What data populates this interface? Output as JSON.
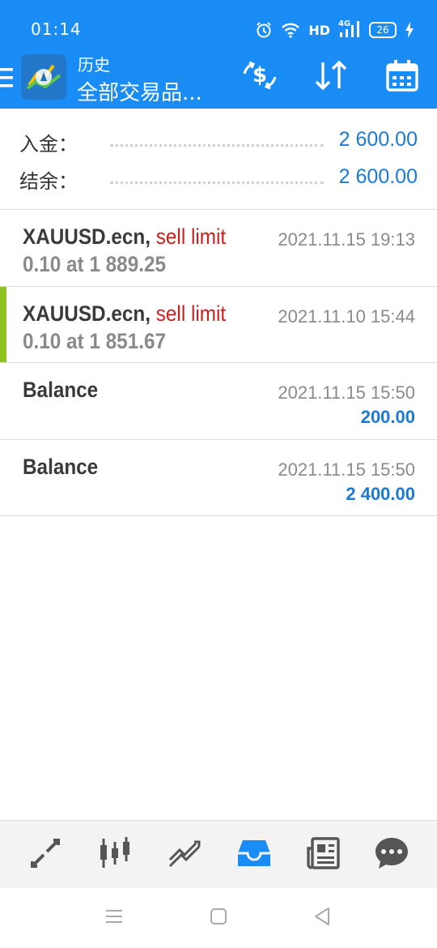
{
  "status_bar": {
    "time": "01:14",
    "network": "HD",
    "signal_label": "4G",
    "battery": "26",
    "icons": [
      "alarm-icon",
      "wifi-icon",
      "signal-icon",
      "battery-icon",
      "charging-icon"
    ]
  },
  "header": {
    "title_small": "历史",
    "title_big": "全部交易品...",
    "buttons": [
      "currency-exchange-icon",
      "sort-icon",
      "calendar-icon"
    ],
    "accent_color": "#1a8cf5"
  },
  "summary": {
    "deposit_label": "入金：",
    "deposit_value": "2 600.00",
    "balance_label": "结余：",
    "balance_value": "2 600.00"
  },
  "deals": [
    {
      "symbol": "XAUUSD.ecn,",
      "type": "sell limit",
      "detail": "0.10 at 1 889.25",
      "time": "2021.11.15 19:13",
      "amount": "",
      "highlighted": false
    },
    {
      "symbol": "XAUUSD.ecn,",
      "type": "sell limit",
      "detail": "0.10 at 1 851.67",
      "time": "2021.11.10 15:44",
      "amount": "",
      "highlighted": true
    },
    {
      "symbol": "Balance",
      "type": "",
      "detail": "",
      "time": "2021.11.15 15:50",
      "amount": "200.00",
      "highlighted": false
    },
    {
      "symbol": "Balance",
      "type": "",
      "detail": "",
      "time": "2021.11.15 15:50",
      "amount": "2 400.00",
      "highlighted": false
    }
  ],
  "bottom_nav": {
    "items": [
      "quotes-icon",
      "chart-icon",
      "trade-icon",
      "history-icon",
      "news-icon",
      "chat-icon"
    ],
    "active_index": 3,
    "active_color": "#1a8cf5",
    "inactive_color": "#555555"
  },
  "system_nav": {
    "items": [
      "menu-icon",
      "home-icon",
      "back-icon"
    ]
  },
  "colors": {
    "value_blue": "#1a7ad6",
    "sell_red": "#cc2020",
    "accent_green": "#8dc21f"
  }
}
